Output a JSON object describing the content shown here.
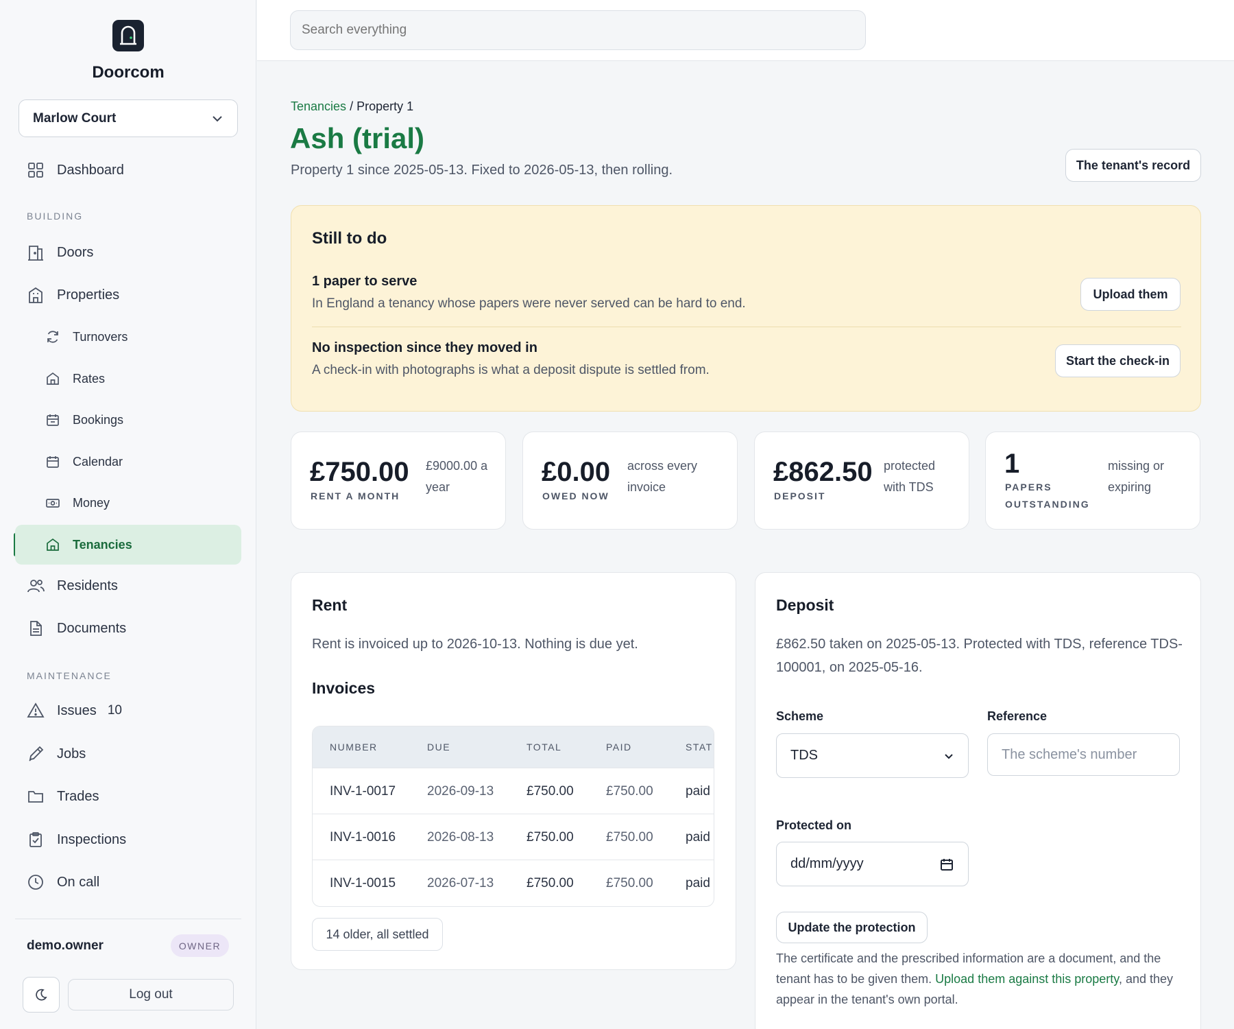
{
  "app": {
    "name": "Doorcom"
  },
  "sidebar": {
    "property_selector": "Marlow Court",
    "dashboard": "Dashboard",
    "section_building": "BUILDING",
    "doors": "Doors",
    "properties": "Properties",
    "turnovers": "Turnovers",
    "rates": "Rates",
    "bookings": "Bookings",
    "calendar": "Calendar",
    "money": "Money",
    "tenancies": "Tenancies",
    "residents": "Residents",
    "documents": "Documents",
    "section_maintenance": "MAINTENANCE",
    "issues": "Issues",
    "issues_count": "10",
    "jobs": "Jobs",
    "trades": "Trades",
    "inspections": "Inspections",
    "on_call": "On call",
    "user": "demo.owner",
    "role": "OWNER",
    "logout": "Log out"
  },
  "search": {
    "placeholder": "Search everything"
  },
  "breadcrumb": {
    "parent": "Tenancies",
    "separator": " / ",
    "current": "Property 1"
  },
  "header": {
    "title": "Ash (trial)",
    "subtitle": "Property 1 since 2025-05-13. Fixed to 2026-05-13, then rolling.",
    "record_button": "The tenant's record"
  },
  "todo": {
    "title": "Still to do",
    "items": [
      {
        "title": "1 paper to serve",
        "desc": "In England a tenancy whose papers were never served can be hard to end.",
        "action": "Upload them"
      },
      {
        "title": "No inspection since they moved in",
        "desc": "A check-in with photographs is what a deposit dispute is settled from.",
        "action": "Start the check-in"
      }
    ]
  },
  "stats": [
    {
      "value": "£750.00",
      "label": "RENT A MONTH",
      "side1": "£9000.00 a",
      "side2": "year"
    },
    {
      "value": "£0.00",
      "label": "OWED NOW",
      "side1": "across every",
      "side2": "invoice"
    },
    {
      "value": "£862.50",
      "label": "DEPOSIT",
      "side1": "protected",
      "side2": "with TDS"
    },
    {
      "value": "1",
      "label1": "PAPERS",
      "label2": "OUTSTANDING",
      "side1": "missing or",
      "side2": "expiring"
    }
  ],
  "rent": {
    "title": "Rent",
    "text": "Rent is invoiced up to 2026-10-13. Nothing is due yet.",
    "invoices_title": "Invoices",
    "columns": [
      "NUMBER",
      "DUE",
      "TOTAL",
      "PAID",
      "STAT"
    ],
    "rows": [
      {
        "number": "INV-1-0017",
        "due": "2026-09-13",
        "total": "£750.00",
        "paid": "£750.00",
        "status": "paid"
      },
      {
        "number": "INV-1-0016",
        "due": "2026-08-13",
        "total": "£750.00",
        "paid": "£750.00",
        "status": "paid"
      },
      {
        "number": "INV-1-0015",
        "due": "2026-07-13",
        "total": "£750.00",
        "paid": "£750.00",
        "status": "paid"
      }
    ],
    "older_button": "14 older, all settled"
  },
  "deposit": {
    "title": "Deposit",
    "text1": "£862.50 taken on 2025-05-13. Protected with TDS, reference TDS-",
    "text2": "100001, on 2025-05-16.",
    "scheme_label": "Scheme",
    "scheme_value": "TDS",
    "reference_label": "Reference",
    "reference_placeholder": "The scheme's number",
    "protected_label": "Protected on",
    "date_placeholder": "dd/mm/yyyy",
    "update_button": "Update the protection",
    "note_before": "The certificate and the prescribed information are a document, and the tenant has to be given them. ",
    "note_link": "Upload them against this property",
    "note_after": ", and they appear in the tenant's own portal."
  },
  "colors": {
    "accent": "#1a7a44",
    "todo_bg": "#fdf3d7",
    "active_bg": "#dcefe3"
  }
}
